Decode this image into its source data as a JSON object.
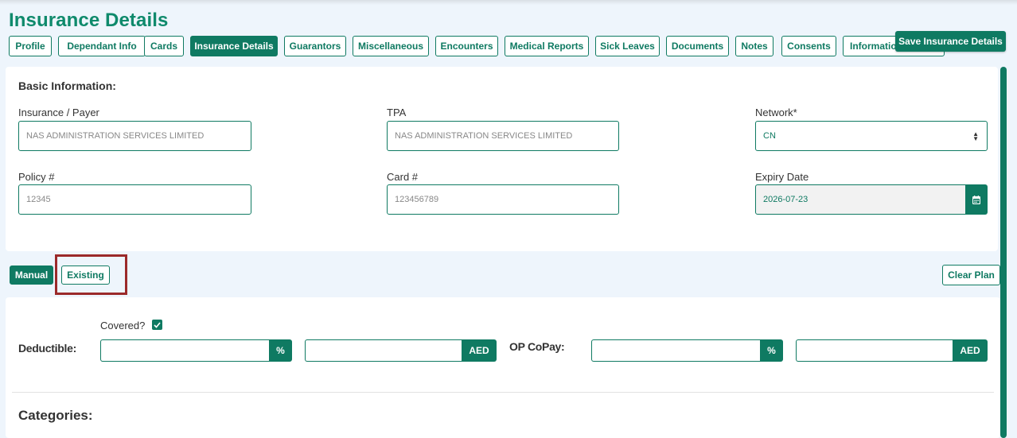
{
  "page": {
    "title": "Insurance Details"
  },
  "tabs": [
    {
      "label": "Profile"
    },
    {
      "label": "Dependant Info"
    },
    {
      "label": "Cards"
    },
    {
      "label": "Insurance Details",
      "active": true
    },
    {
      "label": "Guarantors"
    },
    {
      "label": "Miscellaneous"
    },
    {
      "label": "Encounters"
    },
    {
      "label": "Medical Reports"
    },
    {
      "label": "Sick Leaves"
    },
    {
      "label": "Documents"
    },
    {
      "label": "Notes"
    },
    {
      "label": "Consents"
    },
    {
      "label": "Informatio"
    }
  ],
  "toolbar": {
    "save_label": "Save Insurance Details"
  },
  "basic": {
    "title": "Basic Information:",
    "payer": {
      "label": "Insurance / Payer",
      "placeholder": "NAS ADMINISTRATION SERVICES LIMITED"
    },
    "tpa": {
      "label": "TPA",
      "placeholder": "NAS ADMINISTRATION SERVICES LIMITED"
    },
    "network": {
      "label": "Network*",
      "value": "CN"
    },
    "policy": {
      "label": "Policy #",
      "placeholder": "12345"
    },
    "card": {
      "label": "Card #",
      "placeholder": "123456789"
    },
    "expiry": {
      "label": "Expiry Date",
      "value": "2026-07-23"
    }
  },
  "plan": {
    "manual_label": "Manual",
    "existing_label": "Existing",
    "clear_label": "Clear Plan",
    "covered_label": "Covered?",
    "covered_checked": true,
    "deductible": {
      "label": "Deductible:",
      "percent_unit": "%",
      "amount_unit": "AED"
    },
    "op_copay": {
      "label": "OP CoPay:",
      "percent_unit": "%",
      "amount_unit": "AED"
    }
  },
  "categories": {
    "title": "Categories:"
  },
  "colors": {
    "brand": "#0f7a62",
    "title": "#0f8a6c",
    "highlight": "#9b2a2a"
  },
  "icons": {
    "calendar": "calendar-icon",
    "select_arrows": "select-arrows-icon",
    "check": "check-icon"
  }
}
